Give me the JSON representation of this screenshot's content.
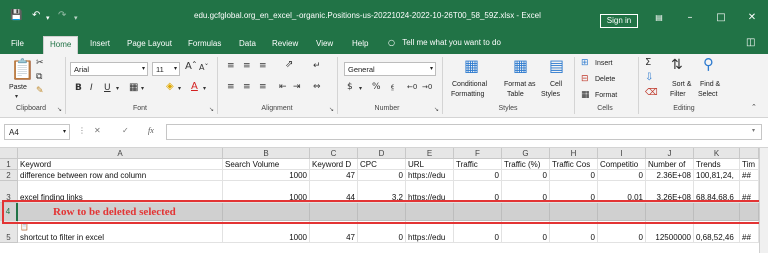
{
  "titlebar": {
    "filename": "edu.gcfglobal.org_en_excel_-organic.Positions-us-20221024-2022-10-26T00_58_59Z.xlsx  -  Excel",
    "signin": "Sign in",
    "minimize": "–",
    "restore": "□",
    "close": "✕"
  },
  "tabs": [
    "File",
    "Home",
    "Insert",
    "Page Layout",
    "Formulas",
    "Data",
    "Review",
    "View",
    "Help"
  ],
  "tellme": "Tell me what you want to do",
  "ribbon": {
    "clipboard": {
      "paste": "Paste",
      "label": "Clipboard"
    },
    "font": {
      "name": "Arial",
      "size": "11",
      "label": "Font"
    },
    "alignment": {
      "label": "Alignment"
    },
    "number": {
      "format": "General",
      "label": "Number"
    },
    "styles": {
      "conditional_1": "Conditional",
      "conditional_2": "Formatting",
      "format_table_1": "Format as",
      "format_table_2": "Table",
      "cell_styles_1": "Cell",
      "cell_styles_2": "Styles",
      "label": "Styles"
    },
    "cells": {
      "insert": "Insert",
      "delete": "Delete",
      "format": "Format",
      "label": "Cells"
    },
    "editing": {
      "sort_1": "Sort &",
      "sort_2": "Filter",
      "find_1": "Find &",
      "find_2": "Select",
      "label": "Editing"
    }
  },
  "formula_bar": {
    "name_box": "A4",
    "fx": "fx",
    "value": ""
  },
  "columns": [
    "A",
    "B",
    "C",
    "D",
    "E",
    "F",
    "G",
    "H",
    "I",
    "J",
    "K"
  ],
  "rows": [
    {
      "num": "1",
      "cells": [
        "Keyword",
        "Search Volume",
        "Keyword D",
        "CPC",
        "URL",
        "Traffic",
        "Traffic (%)",
        "Traffic Cos",
        "Competitio",
        "Number of",
        "Trends",
        "Tim"
      ]
    },
    {
      "num": "2",
      "cells": [
        "difference between row and column",
        "1000",
        "47",
        "0",
        "https://edu",
        "0",
        "0",
        "0",
        "0",
        "2.36E+08",
        "100,81,24,",
        "##"
      ]
    },
    {
      "num": "3",
      "cells": [
        "excel finding links",
        "1000",
        "44",
        "3.2",
        "https://edu",
        "0",
        "0",
        "0",
        "0.01",
        "3.26E+08",
        "68,84,68,6",
        "##"
      ]
    },
    {
      "num": "4",
      "cells": [
        "",
        "",
        "",
        "",
        "",
        "",
        "",
        "",
        "",
        "",
        "",
        ""
      ]
    },
    {
      "num": "5",
      "cells": [
        "shortcut to filter in excel",
        "1000",
        "47",
        "0",
        "https://edu",
        "0",
        "0",
        "0",
        "0",
        "12500000",
        "0,68,52,46",
        "##"
      ]
    }
  ],
  "annotation": "Row to be deleted selected",
  "colors": {
    "excel_green": "#217346",
    "annotation_red": "#e33434",
    "selected_row": "#d0d0d0"
  }
}
